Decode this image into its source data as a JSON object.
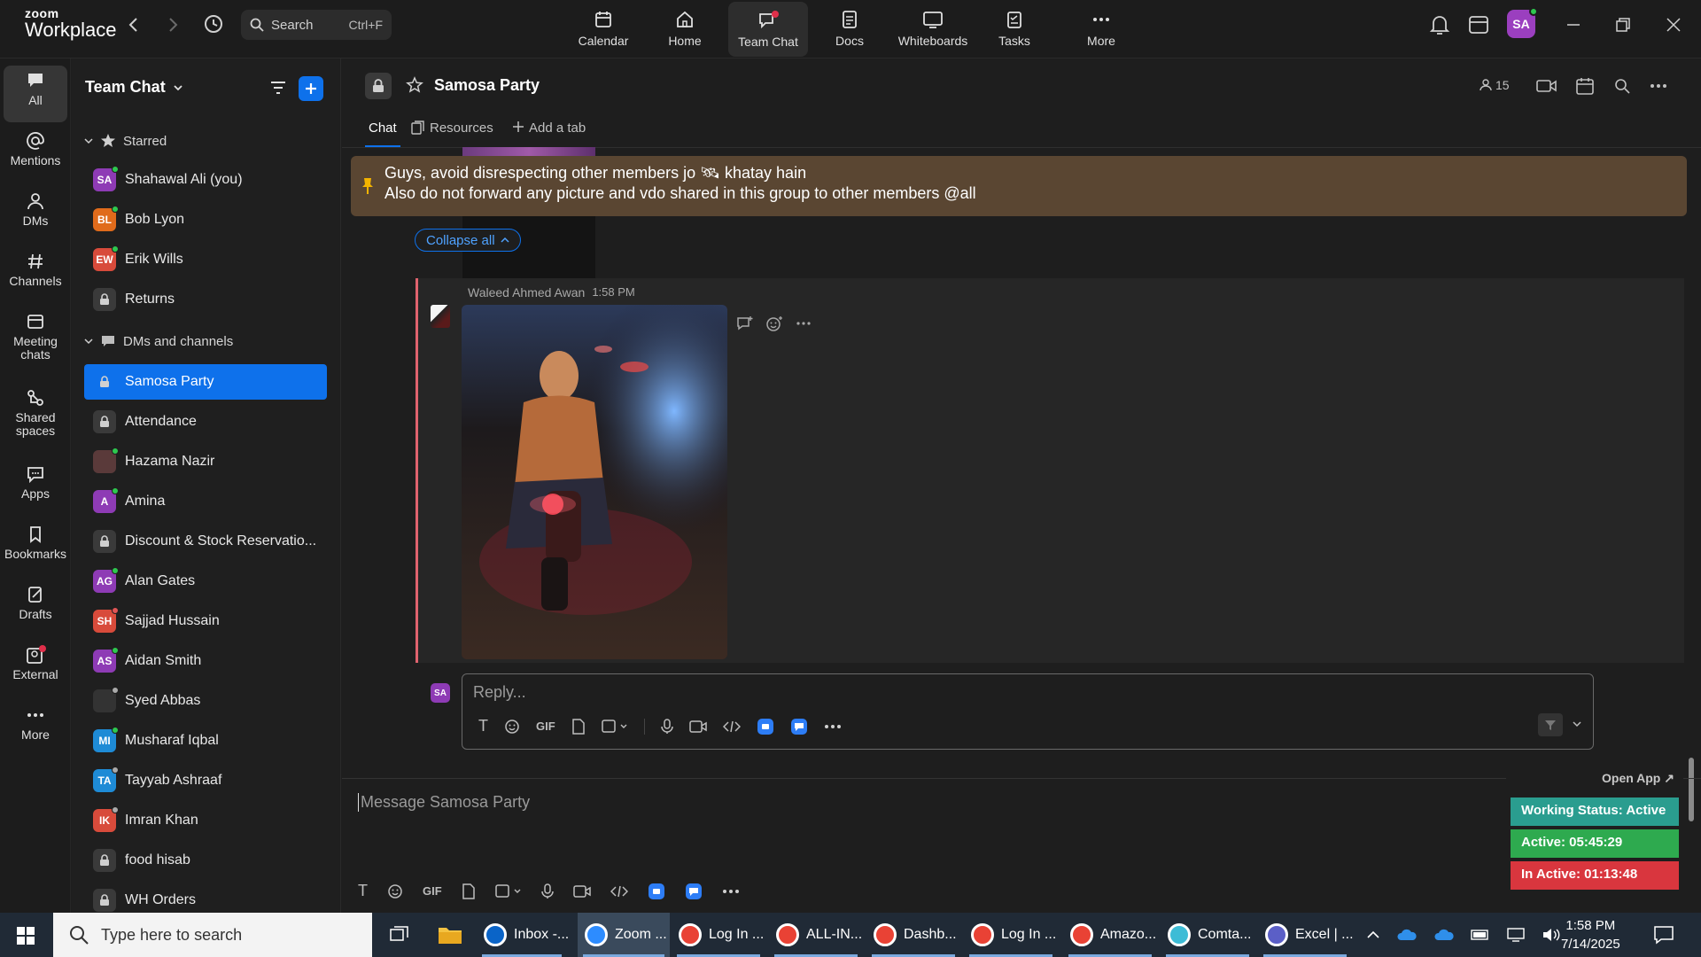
{
  "app": {
    "logo_line1": "zoom",
    "logo_line2": "Workplace"
  },
  "search": {
    "label": "Search",
    "shortcut": "Ctrl+F"
  },
  "topnav": [
    {
      "label": "Calendar"
    },
    {
      "label": "Home"
    },
    {
      "label": "Team Chat"
    },
    {
      "label": "Docs"
    },
    {
      "label": "Whiteboards"
    },
    {
      "label": "Tasks"
    },
    {
      "label": "More"
    }
  ],
  "user": {
    "initials": "SA"
  },
  "rail": [
    {
      "label": "All"
    },
    {
      "label": "Mentions"
    },
    {
      "label": "DMs"
    },
    {
      "label": "Channels"
    },
    {
      "label": "Meeting chats"
    },
    {
      "label": "Shared spaces"
    },
    {
      "label": "Apps"
    },
    {
      "label": "Bookmarks"
    },
    {
      "label": "Drafts"
    },
    {
      "label": "External"
    },
    {
      "label": "More"
    }
  ],
  "sidebar": {
    "title": "Team Chat",
    "starred_label": "Starred",
    "starred": [
      {
        "name": "Shahawal Ali (you)",
        "initials": "SA",
        "color": "#8e3bb5",
        "status": "#2ec84f"
      },
      {
        "name": "Bob Lyon",
        "initials": "BL",
        "color": "#e06b1b",
        "status": "#2ec84f"
      },
      {
        "name": "Erik Wills",
        "initials": "EW",
        "color": "#d84b3b",
        "status": "#2ec84f"
      },
      {
        "name": "Returns",
        "initials": "",
        "color": "",
        "status": ""
      }
    ],
    "dms_label": "DMs and channels",
    "dms": [
      {
        "name": "Samosa Party",
        "initials": "",
        "color": "",
        "status": ""
      },
      {
        "name": "Attendance",
        "initials": "",
        "color": "",
        "status": ""
      },
      {
        "name": "Hazama Nazir",
        "initials": "",
        "color": "#5a3a3a",
        "status": "#2ec84f"
      },
      {
        "name": "Amina",
        "initials": "A",
        "color": "#8e3bb5",
        "status": "#2ec84f"
      },
      {
        "name": "Discount & Stock Reservatio...",
        "initials": "",
        "color": "",
        "status": ""
      },
      {
        "name": "Alan Gates",
        "initials": "AG",
        "color": "#8e3bb5",
        "status": "#2ec84f"
      },
      {
        "name": "Sajjad Hussain",
        "initials": "SH",
        "color": "#d84b3b",
        "status": "#e05555"
      },
      {
        "name": "Aidan Smith",
        "initials": "AS",
        "color": "#8e3bb5",
        "status": "#2ec84f"
      },
      {
        "name": "Syed Abbas",
        "initials": "",
        "color": "#333333",
        "status": "#aaaaaa"
      },
      {
        "name": "Musharaf Iqbal",
        "initials": "MI",
        "color": "#1e8bd6",
        "status": "#2ec84f"
      },
      {
        "name": "Tayyab Ashraaf",
        "initials": "TA",
        "color": "#1e8bd6",
        "status": "#aaaaaa"
      },
      {
        "name": "Imran Khan",
        "initials": "IK",
        "color": "#d84b3b",
        "status": "#aaaaaa"
      },
      {
        "name": "food hisab",
        "initials": "",
        "color": "",
        "status": ""
      },
      {
        "name": "WH Orders",
        "initials": "",
        "color": "",
        "status": ""
      }
    ]
  },
  "channel": {
    "name": "Samosa Party",
    "members": "15",
    "tabs": {
      "chat": "Chat",
      "resources": "Resources",
      "add": "Add a tab"
    },
    "pinned_line1": "Guys, avoid disrespecting other members jo 🛰 khatay hain",
    "pinned_line2": "Also do not forward any picture and vdo shared in this group to other members @all",
    "collapse_all": "Collapse all",
    "message": {
      "sender": "Waleed Ahmed Awan",
      "time": "1:58 PM"
    },
    "reply_placeholder": "Reply...",
    "message_placeholder": "Message Samosa Party",
    "gif": "GIF"
  },
  "widget": {
    "open_app": "Open App ↗",
    "working": "Working Status: Active",
    "active": "Active: 05:45:29",
    "inactive": "In Active: 01:13:48"
  },
  "taskbar": {
    "search_placeholder": "Type here to search",
    "apps": [
      {
        "label": "Inbox -..."
      },
      {
        "label": "Zoom ..."
      },
      {
        "label": "Log In ..."
      },
      {
        "label": "ALL-IN..."
      },
      {
        "label": "Dashb..."
      },
      {
        "label": "Log In ..."
      },
      {
        "label": "Amazo..."
      },
      {
        "label": "Comta..."
      },
      {
        "label": "Excel | ..."
      }
    ],
    "time": "1:58 PM",
    "date": "7/14/2025"
  }
}
